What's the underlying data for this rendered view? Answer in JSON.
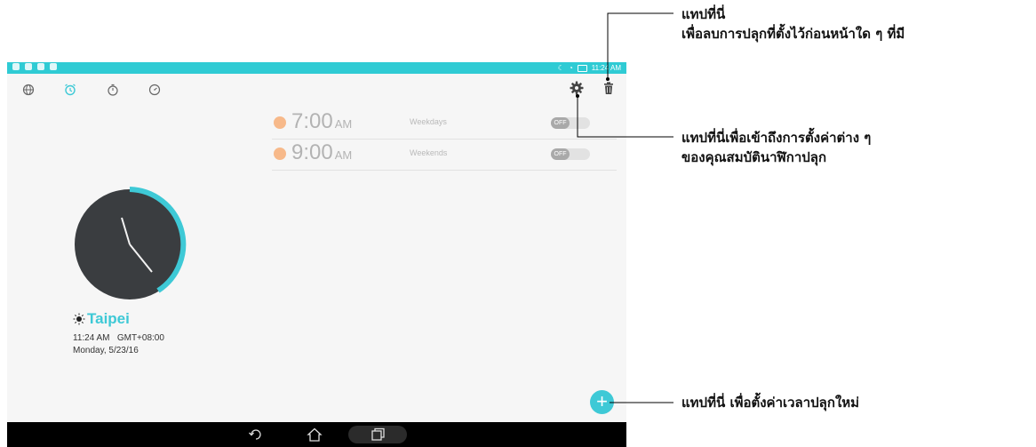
{
  "status_bar": {
    "time": "11:24 AM"
  },
  "tabs": [
    {
      "name": "world-clock",
      "icon": "globe-icon"
    },
    {
      "name": "alarm",
      "icon": "alarm-clock-icon",
      "active": true
    },
    {
      "name": "stopwatch",
      "icon": "stopwatch-icon"
    },
    {
      "name": "timer",
      "icon": "timer-icon"
    }
  ],
  "toolbar": {
    "settings_icon": "gear-icon",
    "delete_icon": "trash-icon"
  },
  "alarms": [
    {
      "time": "7:00",
      "ampm": "AM",
      "days": "Weekdays",
      "toggle": "OFF"
    },
    {
      "time": "9:00",
      "ampm": "AM",
      "days": "Weekends",
      "toggle": "OFF"
    }
  ],
  "world_clock": {
    "city": "Taipei",
    "time_zone": "11:24 AM   GMT+08:00",
    "date": "Monday, 5/23/16"
  },
  "fab": {
    "label": "+"
  },
  "callouts": {
    "delete": {
      "line1": "แทปที่นี่",
      "line2": "เพื่อลบการปลุกที่ตั้งไว้ก่อนหน้าใด ๆ ที่มี"
    },
    "settings": {
      "line1": "แทปที่นี่เพื่อเข้าถึงการตั้งค่าต่าง ๆ",
      "line2": "ของคุณสมบัตินาฬิกาปลุก"
    },
    "add": {
      "line1": "แทปที่นี่ เพื่อตั้งค่าเวลาปลุกใหม่"
    }
  },
  "colors": {
    "accent": "#3ec9d6",
    "status_bar": "#2fcbd4",
    "alarm_sun": "#f7b98a",
    "nav_bar": "#000000"
  }
}
